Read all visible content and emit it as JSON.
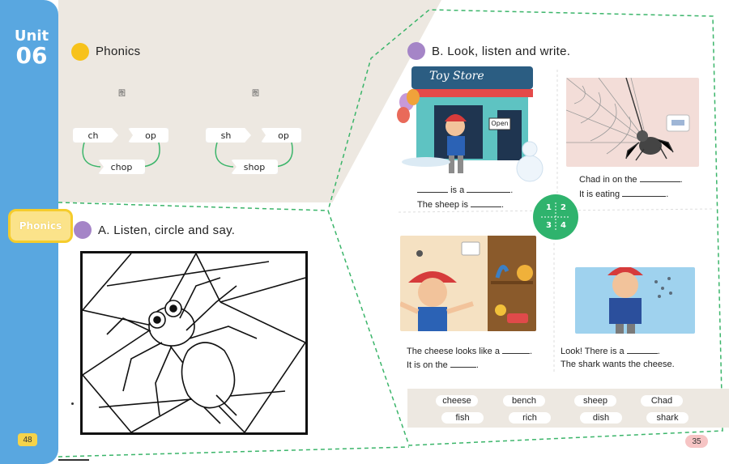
{
  "unit": {
    "word": "Unit",
    "number": "06"
  },
  "side_tab": "Phonics",
  "page_numbers": {
    "left": "48",
    "right": "35"
  },
  "phonics": {
    "title": "Phonics",
    "glyph_left": "图",
    "glyph_right": "图",
    "blend1": {
      "onset": "ch",
      "rime": "op",
      "word": "chop"
    },
    "blend2": {
      "onset": "sh",
      "rime": "op",
      "word": "shop"
    }
  },
  "exercise_a": {
    "title": "A. Listen, circle and say."
  },
  "exercise_b": {
    "title": "B. Look, listen and write.",
    "store_sign": "Toy Store",
    "open_sign": "Open",
    "q1": {
      "line1_mid": "is a",
      "line2": "The sheep is"
    },
    "q2": {
      "line1": "Chad in on the",
      "line2": "It is eating"
    },
    "q3": {
      "line1": "The cheese looks like a",
      "line2": "It is on the"
    },
    "q4": {
      "line1": "Look! There is a",
      "line2": "The shark wants the cheese."
    }
  },
  "clock": {
    "n1": "1",
    "n2": "2",
    "n3": "3",
    "n4": "4"
  },
  "word_bank": [
    "cheese",
    "bench",
    "sheep",
    "Chad",
    "fish",
    "rich",
    "dish",
    "shark"
  ],
  "colors": {
    "strip": "#59a7e0",
    "dot_yellow": "#f7c21b",
    "dot_purple": "#a585c7",
    "clock_green": "#2fb36d",
    "dash_green": "#3bb56a"
  }
}
